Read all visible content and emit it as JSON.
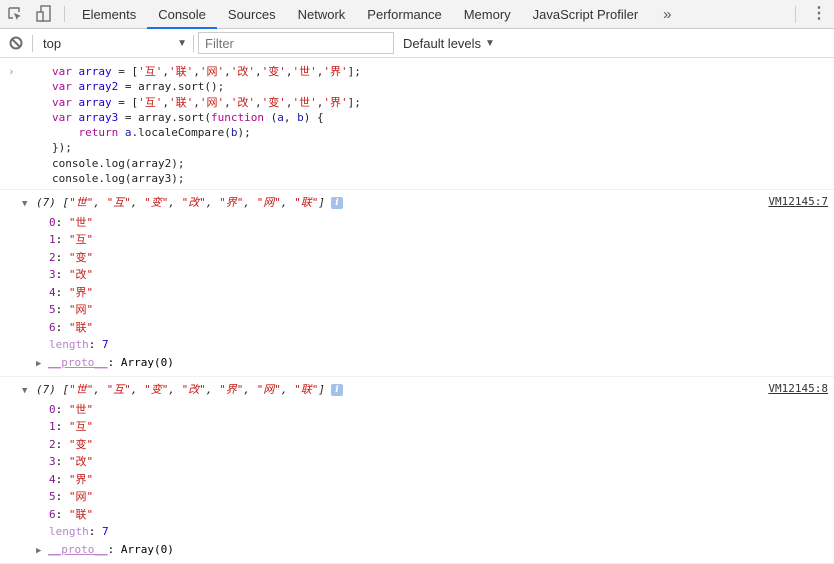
{
  "tabbar": {
    "tabs": [
      {
        "label": "Elements"
      },
      {
        "label": "Console",
        "active": true
      },
      {
        "label": "Sources"
      },
      {
        "label": "Network"
      },
      {
        "label": "Performance"
      },
      {
        "label": "Memory"
      },
      {
        "label": "JavaScript Profiler"
      }
    ],
    "more_label": "»",
    "kebab_label": "⋮"
  },
  "toolbar": {
    "context": "top",
    "filter_placeholder": "Filter",
    "levels_label": "Default levels",
    "dropdown_arrow": "▼"
  },
  "input": {
    "prompt": "›",
    "lines": [
      [
        {
          "t": "kw",
          "v": "var "
        },
        {
          "t": "var",
          "v": "array"
        },
        {
          "t": "",
          "v": " = ["
        },
        {
          "t": "str",
          "v": "'互'"
        },
        {
          "t": "",
          "v": ","
        },
        {
          "t": "str",
          "v": "'联'"
        },
        {
          "t": "",
          "v": ","
        },
        {
          "t": "str",
          "v": "'网'"
        },
        {
          "t": "",
          "v": ","
        },
        {
          "t": "str",
          "v": "'改'"
        },
        {
          "t": "",
          "v": ","
        },
        {
          "t": "str",
          "v": "'变'"
        },
        {
          "t": "",
          "v": ","
        },
        {
          "t": "str",
          "v": "'世'"
        },
        {
          "t": "",
          "v": ","
        },
        {
          "t": "str",
          "v": "'界'"
        },
        {
          "t": "",
          "v": "];"
        }
      ],
      [
        {
          "t": "kw",
          "v": "var "
        },
        {
          "t": "var",
          "v": "array2"
        },
        {
          "t": "",
          "v": " = array.sort();"
        }
      ],
      [
        {
          "t": "kw",
          "v": "var "
        },
        {
          "t": "var",
          "v": "array"
        },
        {
          "t": "",
          "v": " = ["
        },
        {
          "t": "str",
          "v": "'互'"
        },
        {
          "t": "",
          "v": ","
        },
        {
          "t": "str",
          "v": "'联'"
        },
        {
          "t": "",
          "v": ","
        },
        {
          "t": "str",
          "v": "'网'"
        },
        {
          "t": "",
          "v": ","
        },
        {
          "t": "str",
          "v": "'改'"
        },
        {
          "t": "",
          "v": ","
        },
        {
          "t": "str",
          "v": "'变'"
        },
        {
          "t": "",
          "v": ","
        },
        {
          "t": "str",
          "v": "'世'"
        },
        {
          "t": "",
          "v": ","
        },
        {
          "t": "str",
          "v": "'界'"
        },
        {
          "t": "",
          "v": "];"
        }
      ],
      [
        {
          "t": "kw",
          "v": "var "
        },
        {
          "t": "var",
          "v": "array3"
        },
        {
          "t": "",
          "v": " = array.sort("
        },
        {
          "t": "kw",
          "v": "function"
        },
        {
          "t": "",
          "v": " ("
        },
        {
          "t": "varb",
          "v": "a"
        },
        {
          "t": "",
          "v": ", "
        },
        {
          "t": "varb",
          "v": "b"
        },
        {
          "t": "",
          "v": ") {"
        }
      ],
      [
        {
          "t": "",
          "v": "    "
        },
        {
          "t": "kw",
          "v": "return "
        },
        {
          "t": "varb",
          "v": "a"
        },
        {
          "t": "",
          "v": ".localeCompare("
        },
        {
          "t": "varb",
          "v": "b"
        },
        {
          "t": "",
          "v": ");"
        }
      ],
      [
        {
          "t": "",
          "v": "});"
        }
      ],
      [
        {
          "t": "",
          "v": "console.log(array2);"
        }
      ],
      [
        {
          "t": "",
          "v": "console.log(array3);"
        }
      ]
    ]
  },
  "logs": [
    {
      "source": "VM12145:7",
      "count": "(7)",
      "summary_items": [
        "\"世\"",
        "\"互\"",
        "\"变\"",
        "\"改\"",
        "\"界\"",
        "\"网\"",
        "\"联\""
      ],
      "items": [
        {
          "key": "0",
          "value": "\"世\""
        },
        {
          "key": "1",
          "value": "\"互\""
        },
        {
          "key": "2",
          "value": "\"变\""
        },
        {
          "key": "3",
          "value": "\"改\""
        },
        {
          "key": "4",
          "value": "\"界\""
        },
        {
          "key": "5",
          "value": "\"网\""
        },
        {
          "key": "6",
          "value": "\"联\""
        }
      ],
      "length_key": "length",
      "length": "7",
      "proto_key": "__proto__",
      "proto_value": "Array(0)"
    },
    {
      "source": "VM12145:8",
      "count": "(7)",
      "summary_items": [
        "\"世\"",
        "\"互\"",
        "\"变\"",
        "\"改\"",
        "\"界\"",
        "\"网\"",
        "\"联\""
      ],
      "items": [
        {
          "key": "0",
          "value": "\"世\""
        },
        {
          "key": "1",
          "value": "\"互\""
        },
        {
          "key": "2",
          "value": "\"变\""
        },
        {
          "key": "3",
          "value": "\"改\""
        },
        {
          "key": "4",
          "value": "\"界\""
        },
        {
          "key": "5",
          "value": "\"网\""
        },
        {
          "key": "6",
          "value": "\"联\""
        }
      ],
      "length_key": "length",
      "length": "7",
      "proto_key": "__proto__",
      "proto_value": "Array(0)"
    }
  ]
}
